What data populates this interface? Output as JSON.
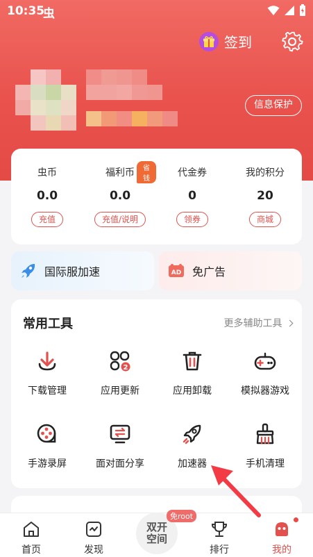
{
  "status_bar": {
    "time": "10:35",
    "app_glyph": "虫"
  },
  "header": {
    "sign_in_label": "签到",
    "privacy_button": "信息保护"
  },
  "wallet": [
    {
      "label": "虫币",
      "value": "0.0",
      "action": "充值"
    },
    {
      "label": "福利币",
      "value": "0.0",
      "action": "充值/说明",
      "tag": "省钱"
    },
    {
      "label": "代金券",
      "value": "0",
      "action": "领券"
    },
    {
      "label": "我的积分",
      "value": "20",
      "action": "商城"
    }
  ],
  "quick_actions": [
    {
      "label": "国际服加速",
      "icon": "rocket-icon"
    },
    {
      "label": "免广告",
      "icon": "ad-block-icon"
    }
  ],
  "tools": {
    "title": "常用工具",
    "more_label": "更多辅助工具",
    "items": [
      {
        "label": "下载管理",
        "icon": "download-icon"
      },
      {
        "label": "应用更新",
        "icon": "app-update-icon",
        "badge": "2"
      },
      {
        "label": "应用卸载",
        "icon": "trash-icon"
      },
      {
        "label": "模拟器游戏",
        "icon": "gamepad-icon"
      },
      {
        "label": "手游录屏",
        "icon": "film-reel-icon"
      },
      {
        "label": "面对面分享",
        "icon": "share-screen-icon"
      },
      {
        "label": "加速器",
        "icon": "rocket-icon"
      },
      {
        "label": "手机清理",
        "icon": "broom-icon"
      }
    ]
  },
  "tabbar": {
    "items": [
      {
        "label": "首页",
        "icon": "home-icon"
      },
      {
        "label": "发现",
        "icon": "discover-icon"
      },
      {
        "label": "排行",
        "icon": "trophy-icon"
      },
      {
        "label": "我的",
        "icon": "profile-icon",
        "active": true
      }
    ],
    "center_line1": "双开",
    "center_line2": "空间",
    "center_badge": "免root"
  },
  "colors": {
    "accent": "#e2514d",
    "header_top": "#f16a63",
    "header_bottom": "#e44a46"
  }
}
